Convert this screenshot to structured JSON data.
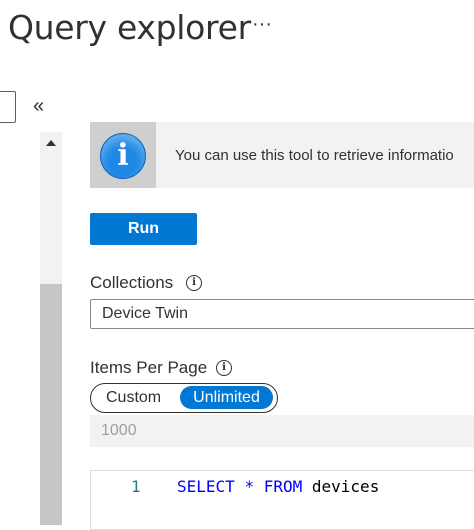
{
  "header": {
    "title": "Query explorer",
    "more_label": "···"
  },
  "sidebar": {
    "collapse_label": "«"
  },
  "info_bar": {
    "icon_glyph": "i",
    "text": "You can use this tool to retrieve informatio"
  },
  "run_label": "Run",
  "collections": {
    "label": "Collections",
    "info_glyph": "i",
    "selected": "Device Twin"
  },
  "items_per_page": {
    "label": "Items Per Page",
    "info_glyph": "i",
    "options": [
      "Custom",
      "Unlimited"
    ],
    "selected": "Unlimited",
    "value_placeholder": "1000"
  },
  "editor": {
    "line_number": "1",
    "tokens": {
      "select": "SELECT",
      "star": "*",
      "from": "FROM",
      "table": "devices"
    }
  },
  "colors": {
    "accent": "#0078d4",
    "info_icon": "#1e88e5"
  }
}
